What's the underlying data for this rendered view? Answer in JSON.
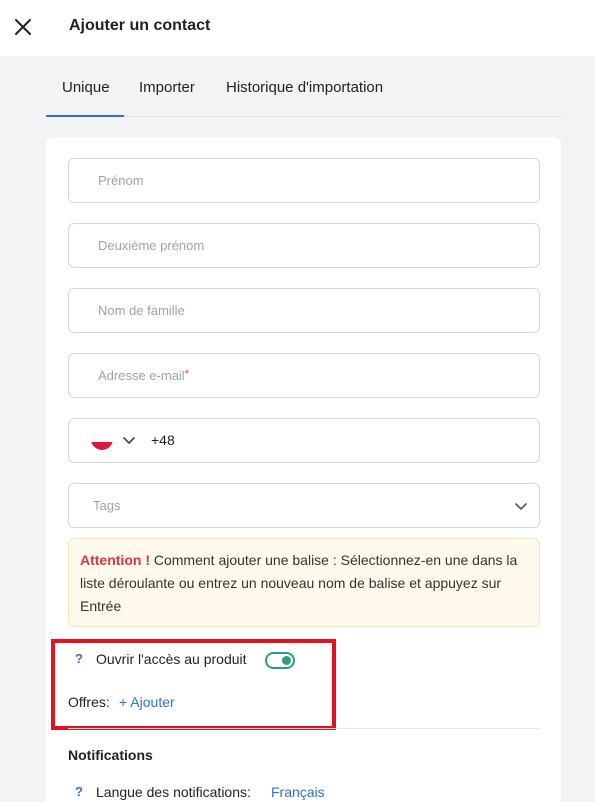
{
  "header": {
    "title": "Ajouter un contact",
    "close_icon": "close-icon"
  },
  "tabs": [
    {
      "label": "Unique",
      "active": true
    },
    {
      "label": "Importer",
      "active": false
    },
    {
      "label": "Historique d'importation",
      "active": false
    }
  ],
  "form": {
    "first_name_placeholder": "Prénom",
    "middle_name_placeholder": "Deuxième prénom",
    "last_name_placeholder": "Nom de famille",
    "email_placeholder": "Adresse e-mail",
    "email_required_mark": "*",
    "phone": {
      "country_flag": "poland-flag-icon",
      "dial_code": "+48"
    },
    "tags_placeholder": "Tags"
  },
  "alert": {
    "strong": "Attention !",
    "text": "Comment ajouter une balise : Sélectionnez-en une dans la liste déroulante ou entrez un nouveau nom de balise et appuyez sur Entrée"
  },
  "product_access": {
    "help": "?",
    "label": "Ouvrir l'accès au produit",
    "enabled": true,
    "offers_label": "Offres:",
    "add_link": "+ Ajouter"
  },
  "notifications": {
    "title": "Notifications",
    "help": "?",
    "language_label": "Langue des notifications:",
    "language_value": "Français"
  },
  "colors": {
    "accent": "#2f6fd6",
    "toggle_on": "#2aa07a",
    "highlight": "#e0131e",
    "alert_red": "#d8343f"
  }
}
